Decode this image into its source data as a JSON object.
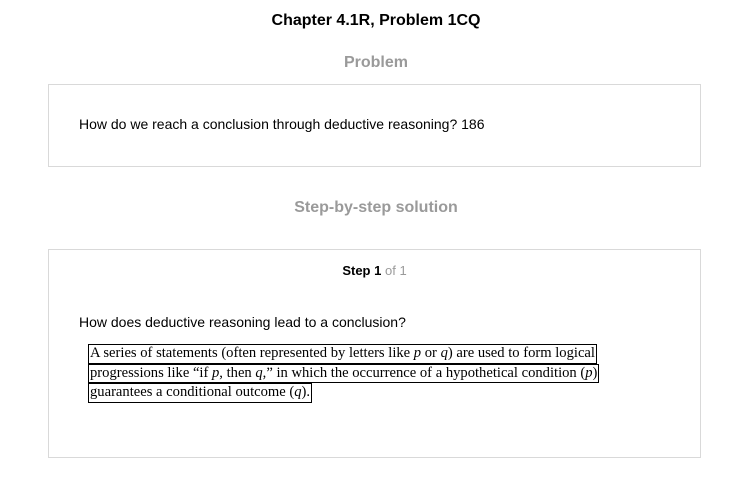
{
  "page": {
    "title": "Chapter 4.1R, Problem 1CQ"
  },
  "problem": {
    "heading": "Problem",
    "text": "How do we reach a conclusion through deductive reasoning? 186"
  },
  "solution": {
    "heading": "Step-by-step solution",
    "step": {
      "label": "Step",
      "number": "1",
      "of_text": "of 1"
    },
    "question": "How does deductive reasoning lead to a conclusion?",
    "answer_lines": [
      {
        "parts": [
          {
            "text": "A series of statements (often represented by letters like ",
            "italic": false
          },
          {
            "text": "p",
            "italic": true
          },
          {
            "text": " or ",
            "italic": false
          },
          {
            "text": "q",
            "italic": true
          },
          {
            "text": ") are used to form logical",
            "italic": false
          }
        ]
      },
      {
        "parts": [
          {
            "text": "progressions like “if ",
            "italic": false
          },
          {
            "text": "p",
            "italic": true
          },
          {
            "text": ", then ",
            "italic": false
          },
          {
            "text": "q",
            "italic": true
          },
          {
            "text": ",” in which the occurrence of a hypothetical condition (",
            "italic": false
          },
          {
            "text": "p",
            "italic": true
          },
          {
            "text": ")",
            "italic": false
          }
        ]
      },
      {
        "parts": [
          {
            "text": "guarantees a conditional outcome (",
            "italic": false
          },
          {
            "text": "q",
            "italic": true
          },
          {
            "text": ").",
            "italic": false
          }
        ]
      }
    ]
  }
}
